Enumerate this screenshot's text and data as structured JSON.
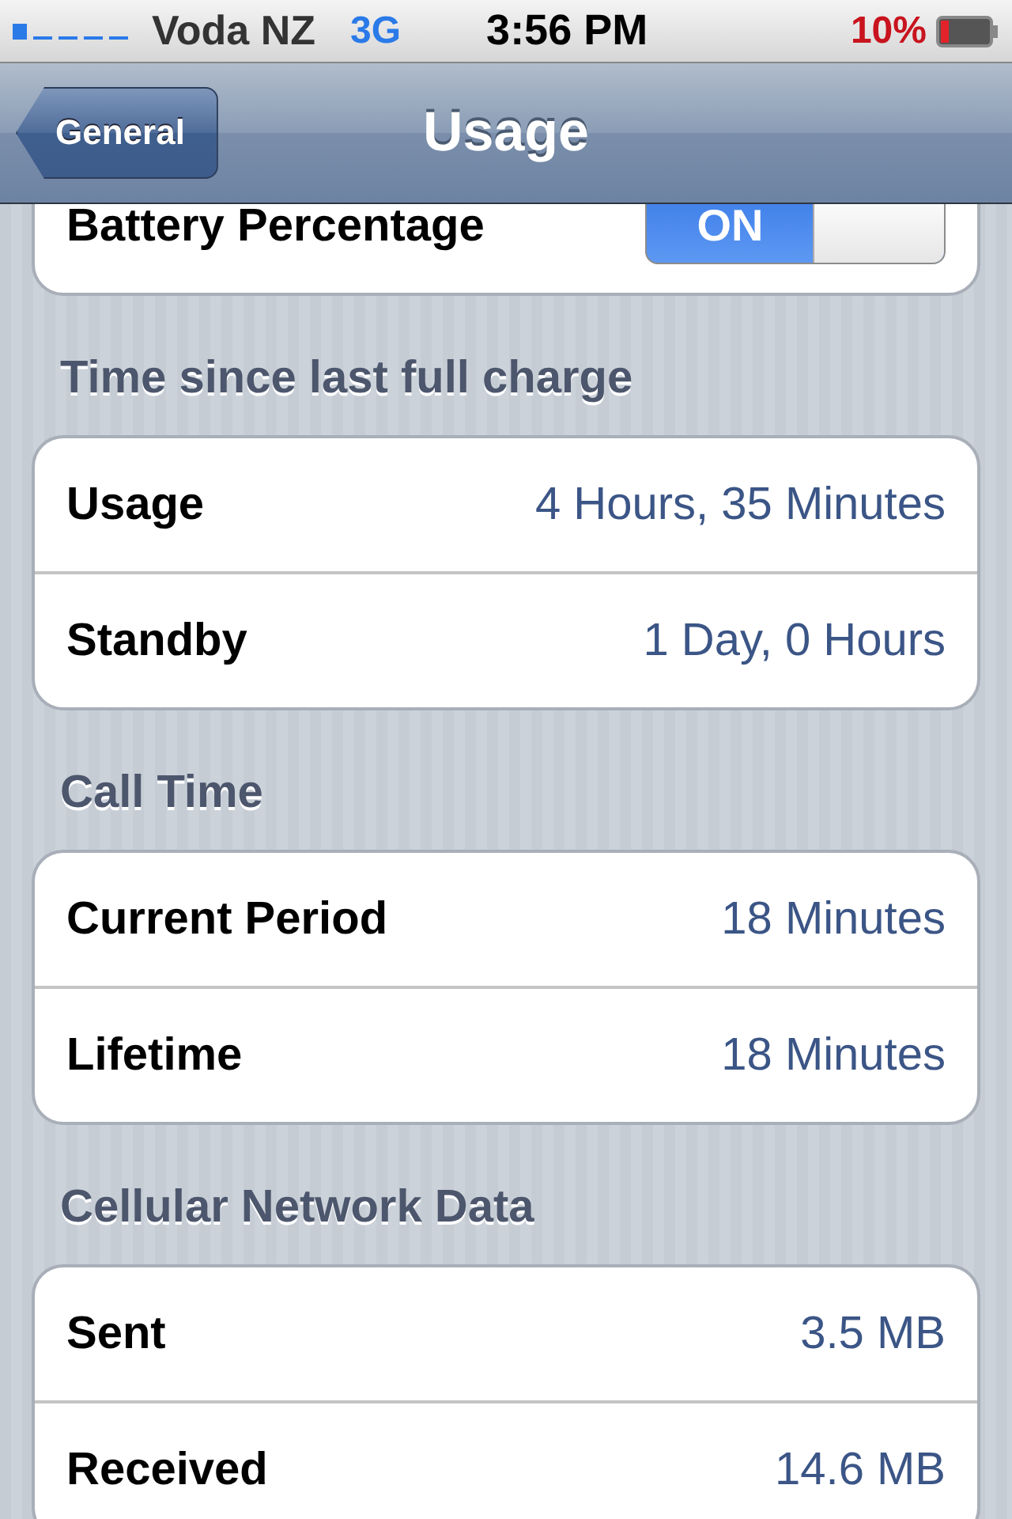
{
  "status_bar": {
    "carrier": "Voda NZ",
    "network": "3G",
    "time": "3:56 PM",
    "battery": "10%"
  },
  "nav_bar": {
    "back": "General",
    "title": "Usage"
  },
  "sections": [
    {
      "rows": [
        {
          "kind": "toggle",
          "label": "Battery Percentage",
          "on": true,
          "on_label": "ON"
        }
      ]
    },
    {
      "header": "Time since last full charge",
      "rows": [
        {
          "kind": "value",
          "label": "Usage",
          "value": "4 Hours, 35 Minutes"
        },
        {
          "kind": "value",
          "label": "Standby",
          "value": "1 Day, 0 Hours"
        }
      ]
    },
    {
      "header": "Call Time",
      "rows": [
        {
          "kind": "value",
          "label": "Current Period",
          "value": "18 Minutes"
        },
        {
          "kind": "value",
          "label": "Lifetime",
          "value": "18 Minutes"
        }
      ]
    },
    {
      "header": "Cellular Network Data",
      "rows": [
        {
          "kind": "value",
          "label": "Sent",
          "value": "3.5 MB"
        },
        {
          "kind": "value",
          "label": "Received",
          "value": "14.6 MB"
        }
      ]
    }
  ]
}
